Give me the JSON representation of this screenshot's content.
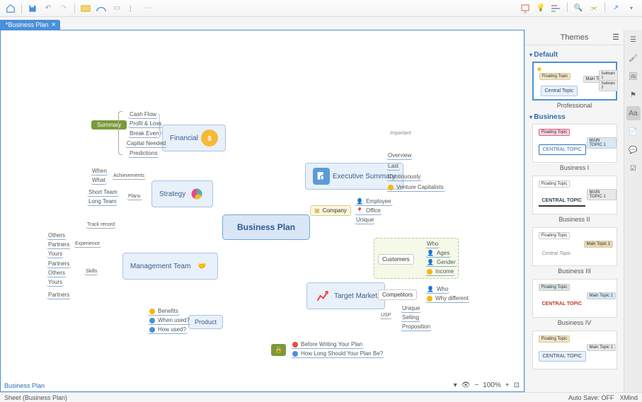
{
  "tab_title": "*Business Plan",
  "themes": {
    "title": "Themes",
    "categories": [
      {
        "name": "Default",
        "items": [
          {
            "label": "Professional",
            "star": true
          }
        ]
      },
      {
        "name": "Business",
        "items": [
          {
            "label": "Business I"
          },
          {
            "label": "Business II"
          },
          {
            "label": "Business III"
          },
          {
            "label": "Business IV"
          }
        ]
      }
    ]
  },
  "status": {
    "sheet": "Sheet (Business Plan)",
    "autosave": "Auto Save: OFF",
    "brand": "XMind"
  },
  "sheet_link": "Business Plan",
  "zoom": "100%",
  "map": {
    "central": "Business Plan",
    "summary_tag": "Summary",
    "callout_important": "Important",
    "branches": {
      "financial": {
        "label": "Financial",
        "leaves": [
          "Cash Flow",
          "Profit & Loss",
          "Break Even",
          "Capital Needed",
          "Predictions"
        ]
      },
      "strategy": {
        "label": "Strategy",
        "groups": [
          {
            "label": "Achievements",
            "leaves": [
              "When",
              "What"
            ]
          },
          {
            "label": "Plans",
            "leaves": [
              "Short Team",
              "Long Team"
            ]
          }
        ]
      },
      "management": {
        "label": "Management Team",
        "groups": [
          {
            "label": "Track record",
            "leaves": []
          },
          {
            "label": "Experience",
            "leaves": [
              "Others",
              "Partners",
              "Yours"
            ]
          },
          {
            "label": "Skills",
            "leaves": [
              "Partners",
              "Others",
              "Yours"
            ]
          },
          {
            "label": "",
            "leaves": [
              "Partners"
            ]
          }
        ]
      },
      "product": {
        "label": "Product",
        "leaves": [
          "Benefits",
          "When used?",
          "How used?"
        ]
      },
      "exec": {
        "label": "Executive Summary",
        "leaves": [
          "Overview",
          "Last",
          "Continuously",
          "Venture Capitalists"
        ]
      },
      "company": {
        "label": "Company",
        "leaves": [
          "Employee",
          "Office",
          "Unique"
        ]
      },
      "target": {
        "label": "Target Market",
        "groups": [
          {
            "label": "Customers",
            "leaves": [
              "Who",
              "Ages",
              "Gender",
              "Income"
            ]
          },
          {
            "label": "Competitors",
            "leaves": [
              "Who",
              "Why different"
            ]
          },
          {
            "label": "USP",
            "leaves": [
              "Unique",
              "Selling",
              "Proposition"
            ]
          }
        ]
      },
      "floating": {
        "leaves": [
          "Before Writing Your Plan",
          "How Long Should Your Plan Be?"
        ]
      }
    }
  }
}
